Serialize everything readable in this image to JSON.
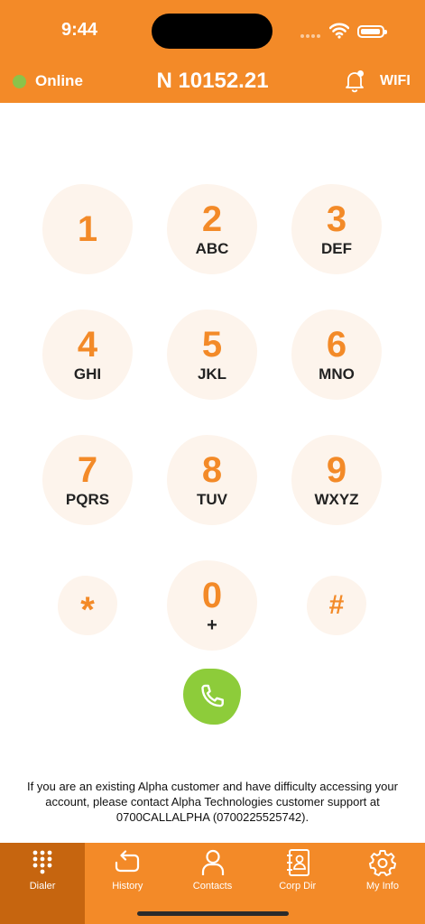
{
  "status_bar": {
    "time": "9:44"
  },
  "header": {
    "status_label": "Online",
    "balance": "N 10152.21",
    "network_label": "WIFI"
  },
  "keypad": [
    {
      "digit": "1",
      "letters": ""
    },
    {
      "digit": "2",
      "letters": "ABC"
    },
    {
      "digit": "3",
      "letters": "DEF"
    },
    {
      "digit": "4",
      "letters": "GHI"
    },
    {
      "digit": "5",
      "letters": "JKL"
    },
    {
      "digit": "6",
      "letters": "MNO"
    },
    {
      "digit": "7",
      "letters": "PQRS"
    },
    {
      "digit": "8",
      "letters": "TUV"
    },
    {
      "digit": "9",
      "letters": "WXYZ"
    },
    {
      "digit": "*",
      "letters": ""
    },
    {
      "digit": "0",
      "letters": "+"
    },
    {
      "digit": "#",
      "letters": ""
    }
  ],
  "notice": "If you are an existing Alpha customer and have difficulty accessing your account, please contact Alpha Technologies customer support at 0700CALLALPHA (0700225525742).",
  "tabs": [
    {
      "label": "Dialer",
      "icon": "dialpad-icon"
    },
    {
      "label": "History",
      "icon": "history-icon"
    },
    {
      "label": "Contacts",
      "icon": "person-icon"
    },
    {
      "label": "Corp Dir",
      "icon": "directory-icon"
    },
    {
      "label": "My Info",
      "icon": "gear-icon"
    }
  ],
  "colors": {
    "brand": "#F38A28",
    "active_tab": "#C6650F",
    "call": "#8DCC3A",
    "online": "#8BC34A",
    "key_bg": "#FDF4EC"
  }
}
